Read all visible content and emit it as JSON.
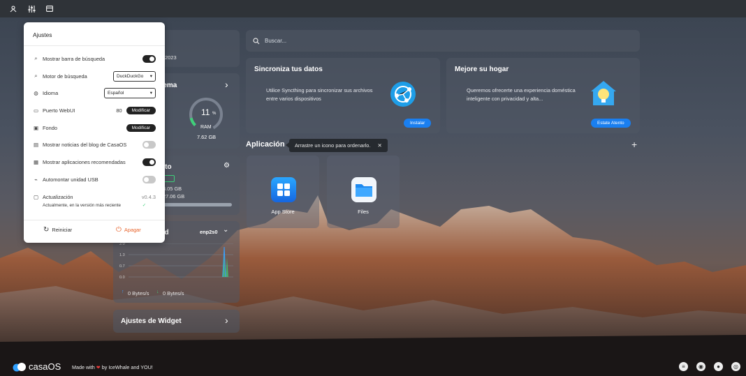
{
  "topbar": {
    "icons": [
      "user-settings-icon",
      "sliders-icon",
      "widget-icon"
    ]
  },
  "search": {
    "placeholder": "Buscar..."
  },
  "promos": [
    {
      "title": "Sincroniza tus datos",
      "desc": "Utilice Syncthing para sincronizar sus archivos entre varios dispositivos",
      "button": "Instalar"
    },
    {
      "title": "Mejore su hogar",
      "desc": "Queremos ofrecerte una experiencia doméstica inteligente con privacidad y alta...",
      "button": "Estate Atento"
    }
  ],
  "apps": {
    "section_title": "Aplicación",
    "tooltip": "Arrastre un icono para ordenarlo.",
    "tooltip_close": "✕",
    "add": "+",
    "items": [
      {
        "name": "App Store"
      },
      {
        "name": "Files"
      }
    ]
  },
  "widgets": {
    "date_fragment": "e 2023",
    "system_title_fragment": "tema",
    "cpu_percent": "11",
    "percent_sign": "%",
    "ram_label": "RAM",
    "ram_value": "7.62 GB",
    "storage_title_fragment": "nto",
    "storage_badge": "",
    "storage_used": "8.05 GB",
    "storage_total": "27.06 GB",
    "network_title_fragment": "ed",
    "network_iface": "enp2s0",
    "network_ticks": [
      "2.0",
      "1.3",
      "0.7",
      "0.0"
    ],
    "network_up": "0 Bytes/s",
    "network_down": "0 Bytes/s",
    "widget_settings": "Ajustes de Widget"
  },
  "settings": {
    "title": "Ajustes",
    "rows": [
      {
        "label": "Mostrar barra de búsqueda",
        "toggle": "on"
      },
      {
        "label": "Motor de búsqueda",
        "select": "DuckDuckGo"
      },
      {
        "label": "Idioma",
        "select": "Español"
      },
      {
        "label": "Puerto WebUI",
        "value": "80",
        "button": "Modificar"
      },
      {
        "label": "Fondo",
        "button": "Modificar"
      },
      {
        "label": "Mostrar noticias del blog de CasaOS",
        "toggle": "off"
      },
      {
        "label": "Mostrar aplicaciones recomendadas",
        "toggle": "on"
      },
      {
        "label": "Automontar unidad USB",
        "toggle": "off"
      }
    ],
    "update_label": "Actualización",
    "update_version": "v0.4.3",
    "update_status": "Actualmente, en la versión más reciente",
    "reboot": "Reiniciar",
    "shutdown": "Apagar"
  },
  "footer": {
    "logo": "casaOS",
    "made_prefix": "Made with",
    "made_suffix": "by IceWhale and YOU!",
    "icons": [
      "forum-icon",
      "discord-icon",
      "github-icon",
      "chat-icon"
    ]
  },
  "colors": {
    "accent": "#1a7ff0",
    "danger": "#e8642c",
    "heart": "#e83a3a"
  }
}
